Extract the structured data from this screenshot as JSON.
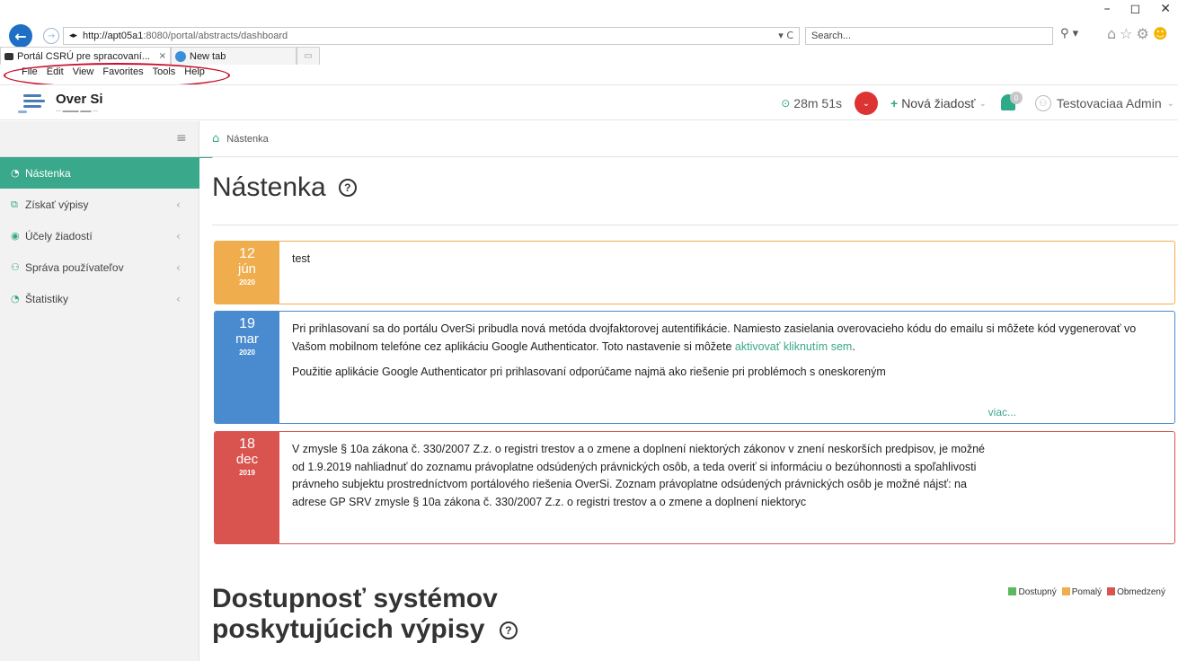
{
  "browser": {
    "url_host": "http://apt05a1",
    "url_rest": ":8080/portal/abstracts/dashboard",
    "refresh_label": "▾ C",
    "search_placeholder": "Search...",
    "tabs": [
      {
        "label": "Portál CSRÚ pre spracovaní...",
        "close": "×"
      },
      {
        "label": "New tab"
      }
    ],
    "menu": [
      "File",
      "Edit",
      "View",
      "Favorites",
      "Tools",
      "Help"
    ]
  },
  "header": {
    "logo_text": "Over Si",
    "logo_sub": "— ▬▬▬ ▬▬ —",
    "timer": "28m 51s",
    "new_request": "Nová žiadosť",
    "bell_count": "0",
    "user_name": "Testovaciaa Admin"
  },
  "sidebar": {
    "items": [
      {
        "label": "Nástenka",
        "icon": "dashboard-icon"
      },
      {
        "label": "Získať výpisy",
        "icon": "copy-icon"
      },
      {
        "label": "Účely žiadostí",
        "icon": "target-icon"
      },
      {
        "label": "Správa používateľov",
        "icon": "users-icon"
      },
      {
        "label": "Štatistiky",
        "icon": "stats-icon"
      }
    ]
  },
  "breadcrumb": {
    "label": "Nástenka"
  },
  "main": {
    "title": "Nástenka",
    "news": [
      {
        "day": "12",
        "month": "jún",
        "year": "2020",
        "color": "#f0ad4e",
        "paragraphs": [
          "test"
        ]
      },
      {
        "day": "19",
        "month": "mar",
        "year": "2020",
        "color": "#4a8bd0",
        "p1": "Pri prihlasovaní sa do portálu OverSi pribudla nová metóda dvojfaktorovej autentifikácie. Namiesto zasielania overovacieho kódu do emailu si môžete kód vygenerovať vo Vašom mobilnom telefóne cez aplikáciu Google Authenticator. Toto nastavenie si môžete ",
        "link": "aktivovať kliknutím sem",
        "p1_end": ".",
        "p2": "Použitie aplikácie Google Authenticator pri prihlasovaní odporúčame najmä ako riešenie pri problémoch s oneskoreným",
        "more": "viac..."
      },
      {
        "day": "18",
        "month": "dec",
        "year": "2019",
        "color": "#d9534f",
        "p1": "V zmysle § 10a zákona č. 330/2007 Z.z. o registri trestov a o zmene a doplnení niektorých zákonov v znení neskorších predpisov, je možné od 1.9.2019 nahliadnuť do zoznamu právoplatne odsúdených právnických osôb, a teda overiť si informáciu o bezúhonnosti a spoľahlivosti právneho subjektu prostredníctvom portálového riešenia OverSi. Zoznam právoplatne odsúdených právnických osôb je možné nájsť: na adrese GP SRV zmysle § 10a zákona č. 330/2007 Z.z. o registri trestov a o zmene a doplnení niektoryc"
      }
    ],
    "section_title": "Dostupnosť systémov poskytujúcich výpisy",
    "legend": [
      {
        "label": "Dostupný",
        "color": "#5cb85c"
      },
      {
        "label": "Pomalý",
        "color": "#f0ad4e"
      },
      {
        "label": "Obmedzený",
        "color": "#d9534f"
      }
    ]
  }
}
